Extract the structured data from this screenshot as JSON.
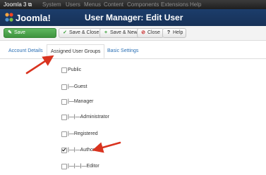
{
  "navbar": {
    "brand": "Joomla 3 ⧉",
    "menu": [
      "System",
      "Users",
      "Menus",
      "Content",
      "Components",
      "Extensions",
      "Help"
    ]
  },
  "header": {
    "logo_text": "Joomla!",
    "title": "User Manager: Edit User"
  },
  "toolbar": {
    "save": "Save",
    "save_close": "Save & Close",
    "save_new": "Save & New",
    "close": "Close",
    "help": "Help"
  },
  "tabs": [
    "Account Details",
    "Assigned User Groups",
    "Basic Settings"
  ],
  "active_tab": "Assigned User Groups",
  "groups": [
    {
      "label": "Public",
      "checked": false
    },
    {
      "label": "|—Guest",
      "checked": false
    },
    {
      "label": "|—Manager",
      "checked": false
    },
    {
      "label": "|—|—Administrator",
      "checked": false
    },
    {
      "label": "|—Registered",
      "checked": false
    },
    {
      "label": "|—|—Author",
      "checked": true
    },
    {
      "label": "|—|—|—Editor",
      "checked": false
    }
  ],
  "colors": {
    "navbar": "#2b2b2b",
    "header": "#1a3867",
    "save_green": "#51a351",
    "link_blue": "#2a6fb4",
    "annotation_red": "#d9331f"
  }
}
